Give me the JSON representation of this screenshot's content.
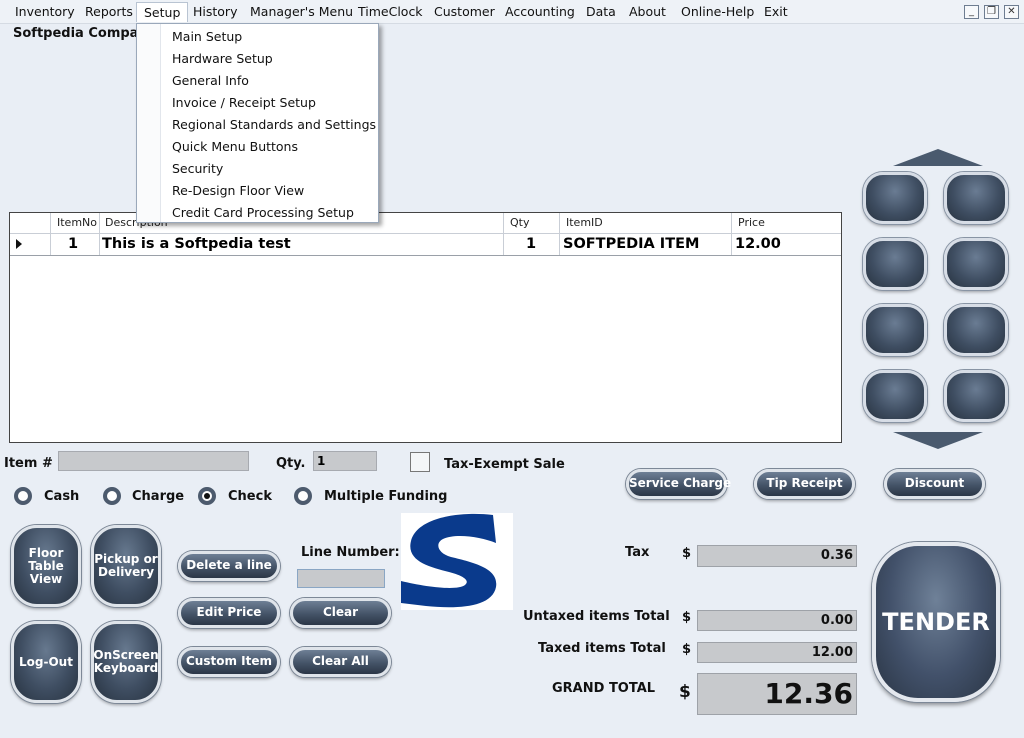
{
  "menubar": {
    "items": [
      "Inventory",
      "Reports",
      "Setup",
      "History",
      "Manager's Menu",
      "TimeClock",
      "Customer",
      "Accounting",
      "Data",
      "About",
      "Online-Help",
      "Exit"
    ],
    "window_controls": [
      "_",
      "❐",
      "✕"
    ]
  },
  "setup_menu": {
    "items": [
      "Main Setup",
      "Hardware Setup",
      "General Info",
      "Invoice / Receipt Setup",
      "Regional Standards and Settings",
      "Quick Menu Buttons",
      "Security",
      "Re-Design Floor View",
      "Credit Card Processing Setup"
    ]
  },
  "company_name": "Softpedia Company",
  "grid": {
    "columns": [
      "ItemNo",
      "Description",
      "Qty",
      "ItemID",
      "Price"
    ],
    "rows": [
      {
        "itemno": "1",
        "description": "This is a Softpedia test",
        "qty": "1",
        "itemid": "SOFTPEDIA ITEM",
        "price": "12.00"
      }
    ]
  },
  "entry": {
    "item_label": "Item #",
    "item_value": "",
    "qty_label": "Qty.",
    "qty_value": "1",
    "tax_exempt_label": "Tax-Exempt Sale"
  },
  "payment": {
    "options": [
      "Cash",
      "Charge",
      "Check",
      "Multiple Funding"
    ],
    "selected": "Check"
  },
  "side_buttons": {
    "service_charge": "Service Charge",
    "tip_receipt": "Tip Receipt",
    "discount": "Discount"
  },
  "left_buttons": {
    "floor_table_view": "Floor Table View",
    "pickup_delivery": "Pickup or Delivery",
    "logout": "Log-Out",
    "onscreen_keyboard": "OnScreen Keyboard"
  },
  "line_actions": {
    "delete_line": "Delete a line",
    "edit_price": "Edit Price",
    "custom_item": "Custom Item",
    "clear": "Clear",
    "clear_all": "Clear All",
    "line_number_label": "Line Number:",
    "line_number_value": ""
  },
  "totals": {
    "currency": "$",
    "tax_label": "Tax",
    "tax": "0.36",
    "untaxed_label": "Untaxed items Total",
    "untaxed": "0.00",
    "taxed_label": "Taxed items Total",
    "taxed": "12.00",
    "grand_label": "GRAND TOTAL",
    "grand": "12.36"
  },
  "tender_label": "TENDER",
  "colors": {
    "background": "#e9eef5",
    "button_dark": "#3f4e62",
    "logo_blue": "#0a3a8c"
  }
}
